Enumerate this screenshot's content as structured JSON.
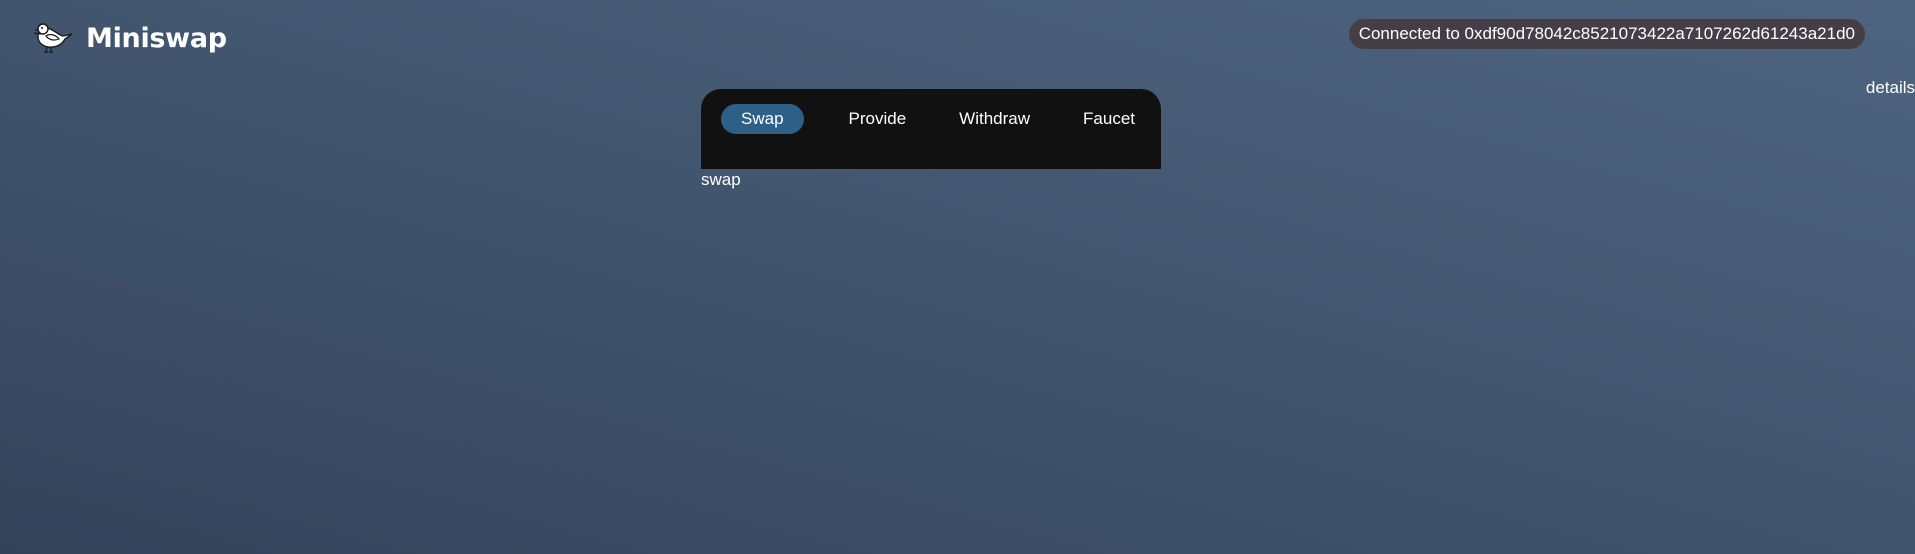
{
  "header": {
    "logo_icon": "dove-icon",
    "app_name": "Miniswap",
    "connection_status": "Connected to 0xdf90d78042c8521073422a7107262d61243a21d0",
    "details_link": "details"
  },
  "tabs": [
    {
      "label": "Swap",
      "active": true
    },
    {
      "label": "Provide",
      "active": false
    },
    {
      "label": "Withdraw",
      "active": false
    },
    {
      "label": "Faucet",
      "active": false
    }
  ],
  "main": {
    "section_label": "swap"
  },
  "colors": {
    "active_tab": "#2e5f86",
    "panel_background": "#111111",
    "badge_background": "#463e46"
  }
}
